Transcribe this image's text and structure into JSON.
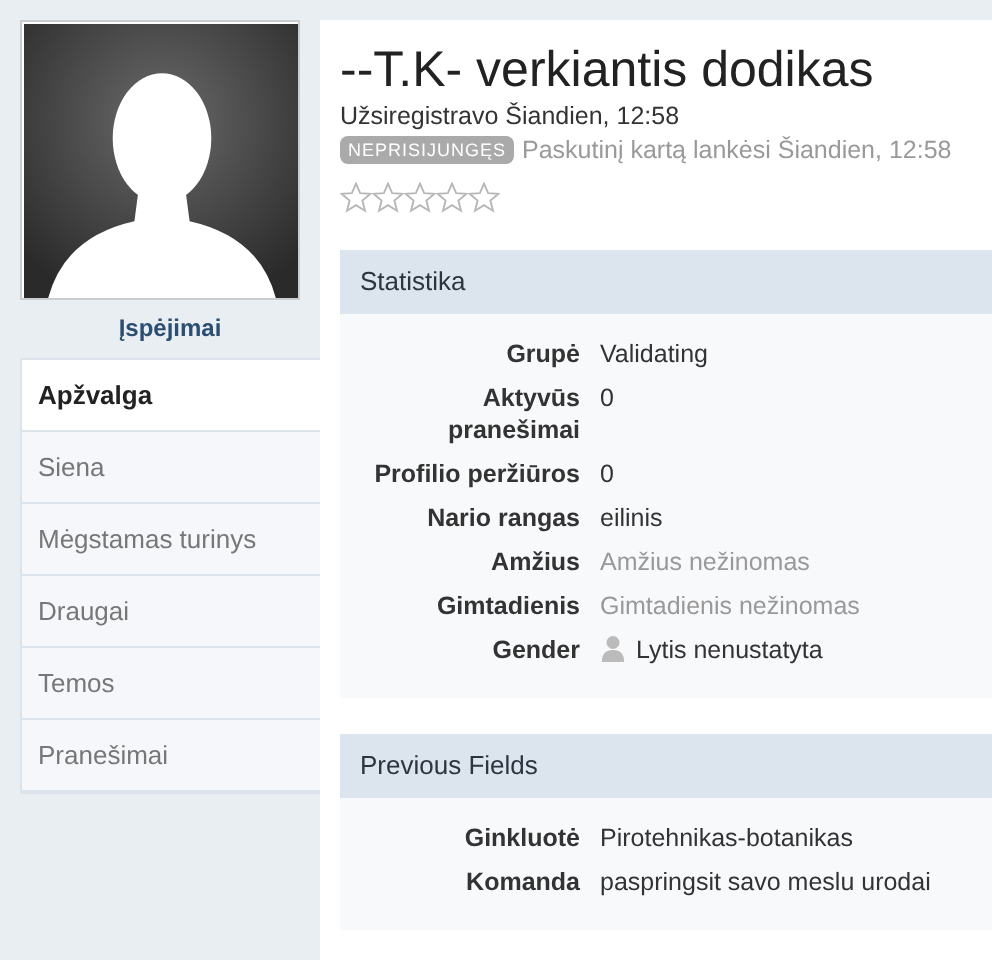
{
  "profile": {
    "warnings_link": "Įspėjimai",
    "name": "--T.K- verkiantis dodikas",
    "registered": "Užsiregistravo Šiandien, 12:58",
    "status_badge": "NEPRISIJUNGĘS",
    "last_visit": "Paskutinį kartą lankėsi Šiandien, 12:58",
    "stars": 0
  },
  "nav": [
    {
      "label": "Apžvalga",
      "selected": true
    },
    {
      "label": "Siena",
      "selected": false
    },
    {
      "label": "Mėgstamas turinys",
      "selected": false
    },
    {
      "label": "Draugai",
      "selected": false
    },
    {
      "label": "Temos",
      "selected": false
    },
    {
      "label": "Pranešimai",
      "selected": false
    }
  ],
  "sections": [
    {
      "title": "Statistika",
      "rows": [
        {
          "label": "Grupė",
          "value": "Validating",
          "muted": false,
          "kind": "text"
        },
        {
          "label": "Aktyvūs pranešimai",
          "value": "0",
          "muted": false,
          "kind": "text"
        },
        {
          "label": "Profilio peržiūros",
          "value": "0",
          "muted": false,
          "kind": "text"
        },
        {
          "label": "Nario rangas",
          "value": "eilinis",
          "muted": false,
          "kind": "text"
        },
        {
          "label": "Amžius",
          "value": "Amžius nežinomas",
          "muted": true,
          "kind": "text"
        },
        {
          "label": "Gimtadienis",
          "value": "Gimtadienis nežinomas",
          "muted": true,
          "kind": "text"
        },
        {
          "label": "Gender",
          "value": "Lytis nenustatyta",
          "muted": false,
          "kind": "gender"
        }
      ]
    },
    {
      "title": "Previous Fields",
      "rows": [
        {
          "label": "Ginkluotė",
          "value": "Pirotehnikas-botanikas",
          "muted": false,
          "kind": "text"
        },
        {
          "label": "Komanda",
          "value": "paspringsit savo meslu urodai",
          "muted": false,
          "kind": "text"
        }
      ]
    }
  ]
}
